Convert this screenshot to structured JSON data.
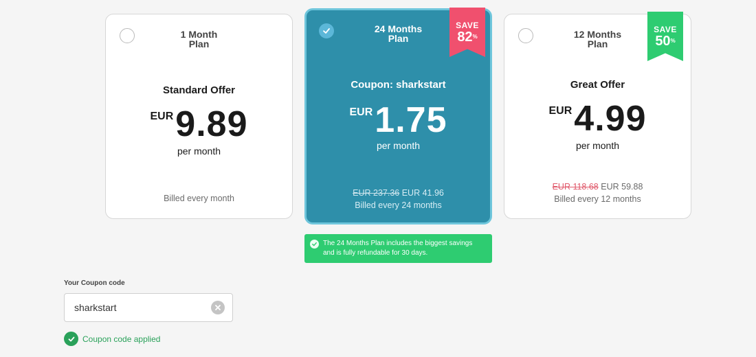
{
  "plans": {
    "monthly": {
      "name_line1": "1 Month",
      "name_line2": "Plan",
      "offer": "Standard Offer",
      "currency": "EUR",
      "price": "9.89",
      "per": "per month",
      "billing": "Billed every month"
    },
    "biennial": {
      "name_line1": "24 Months",
      "name_line2": "Plan",
      "offer": "Coupon: sharkstart",
      "currency": "EUR",
      "price": "1.75",
      "per": "per month",
      "old_price": "EUR 237.36",
      "new_price": "EUR 41.96",
      "billing": "Billed every 24 months",
      "badge_save": "SAVE",
      "badge_pct": "82",
      "badge_pct_sign": "%",
      "selected": true
    },
    "annual": {
      "name_line1": "12 Months",
      "name_line2": "Plan",
      "offer": "Great Offer",
      "currency": "EUR",
      "price": "4.99",
      "per": "per month",
      "old_price": "EUR 118.68",
      "new_price": "EUR 59.88",
      "billing": "Billed every 12 months",
      "badge_save": "SAVE",
      "badge_pct": "50",
      "badge_pct_sign": "%"
    }
  },
  "notice": {
    "line1": "The 24 Months Plan includes the biggest savings",
    "line2": "and is fully refundable for 30 days."
  },
  "coupon": {
    "label": "Your Coupon code",
    "value": "sharkstart",
    "status": "Coupon code applied"
  },
  "colors": {
    "selected_card": "#2e8faa",
    "badge_red": "#f0506e",
    "badge_green": "#2ecc71",
    "success_green": "#2aa15a",
    "strike_red": "#e0596b"
  },
  "icons": {
    "radio_checked": "check-icon",
    "clear": "close-icon",
    "applied": "check-circle-icon"
  }
}
